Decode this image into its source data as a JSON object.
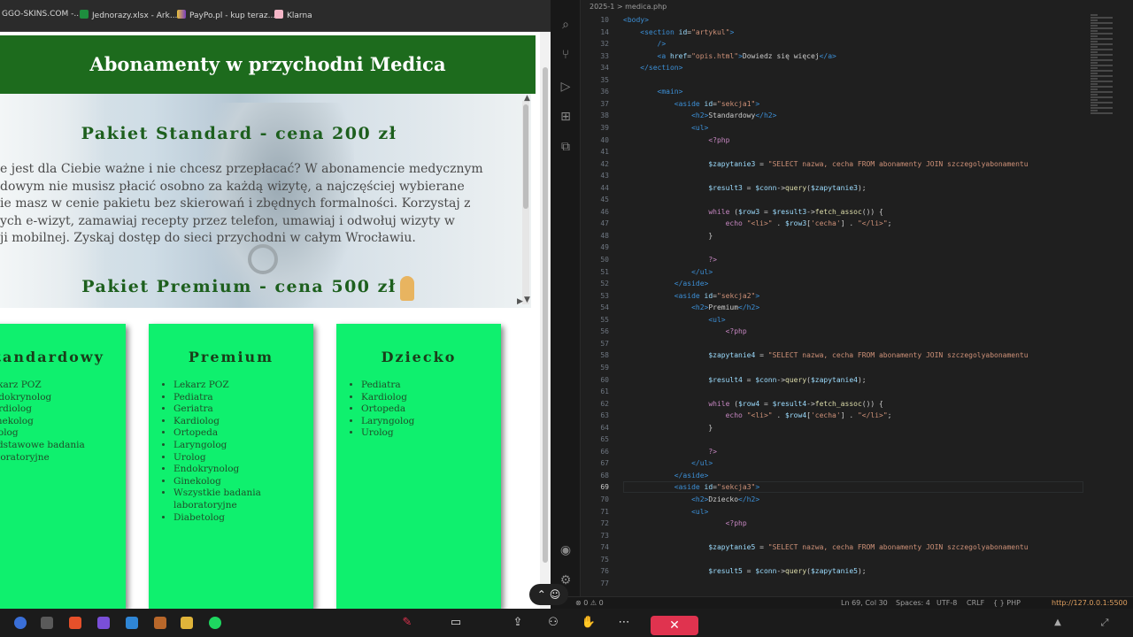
{
  "bookmarks": [
    "GGO-SKINS.COM -...",
    "Jednorazy.xlsx - Ark...",
    "PayPo.pl - kup teraz...",
    "Klarna"
  ],
  "page": {
    "header": "Abonamenty w przychodni Medica",
    "article": {
      "h_standard": "Pakiet Standard - cena 200 zł",
      "text_lines": [
        "e jest dla Ciebie ważne i nie chcesz przepłacać? W abonamencie medycznym",
        "dowym nie musisz płacić osobno za każdą wizytę, a najczęściej wybierane",
        "ie masz w cenie pakietu bez skierowań i zbędnych formalności. Korzystaj z",
        "ych e-wizyt, zamawiaj recepty przez telefon, umawiaj i odwołuj wizyty w",
        "ji mobilnej. Zyskaj dostęp do sieci przychodni w całym Wrocławiu."
      ],
      "h_premium": "Pakiet Premium - cena 500 zł"
    },
    "cards": [
      {
        "title": "Standardowy",
        "items": [
          "Lekarz POZ",
          "Endokrynolog",
          "Kardiolog",
          "Ginekolog",
          "Urolog",
          "Podstawowe badania",
          "laboratoryjne"
        ]
      },
      {
        "title": "Premium",
        "items": [
          "Lekarz POZ",
          "Pediatra",
          "Geriatra",
          "Kardiolog",
          "Ortopeda",
          "Laryngolog",
          "Urolog",
          "Endokrynolog",
          "Ginekolog",
          "Wszystkie badania",
          "laboratoryjne",
          "Diabetolog"
        ]
      },
      {
        "title": "Dziecko",
        "items": [
          "Pediatra",
          "Kardiolog",
          "Ortopeda",
          "Laryngolog",
          "Urolog"
        ]
      }
    ]
  },
  "editor": {
    "breadcrumb": "2025-1 > medica.php",
    "lines": [
      {
        "n": "10",
        "html": "<span class='t'>&lt;body&gt;</span>"
      },
      {
        "n": "14",
        "html": "    <span class='t'>&lt;section</span> <span class='a'>id</span>=<span class='s'>\"artykul\"</span><span class='t'>&gt;</span>"
      },
      {
        "n": "32",
        "html": "        <span class='t'>/&gt;</span>"
      },
      {
        "n": "33",
        "html": "        <span class='t'>&lt;a</span> <span class='a'>href</span>=<span class='s'>\"opis.html\"</span><span class='t'>&gt;</span>Dowiedz się więcej<span class='t'>&lt;/a&gt;</span>"
      },
      {
        "n": "34",
        "html": "    <span class='t'>&lt;/section&gt;</span>"
      },
      {
        "n": "35",
        "html": ""
      },
      {
        "n": "36",
        "html": "        <span class='t'>&lt;main&gt;</span>"
      },
      {
        "n": "37",
        "html": "            <span class='t'>&lt;aside</span> <span class='a'>id</span>=<span class='s'>\"sekcja1\"</span><span class='t'>&gt;</span>"
      },
      {
        "n": "38",
        "html": "                <span class='t'>&lt;h2&gt;</span>Standardowy<span class='t'>&lt;/h2&gt;</span>"
      },
      {
        "n": "39",
        "html": "                <span class='t'>&lt;ul&gt;</span>"
      },
      {
        "n": "40",
        "html": "                    <span class='p'>&lt;?php</span>"
      },
      {
        "n": "41",
        "html": ""
      },
      {
        "n": "42",
        "html": "                    <span class='v'>$zapytanie3</span> = <span class='s'>\"SELECT nazwa, cecha FROM abonamenty JOIN szczegolyabonamentu</span>"
      },
      {
        "n": "43",
        "html": ""
      },
      {
        "n": "44",
        "html": "                    <span class='v'>$result3</span> = <span class='v'>$conn</span>-&gt;<span class='f'>query</span>(<span class='v'>$zapytanie3</span>);"
      },
      {
        "n": "45",
        "html": ""
      },
      {
        "n": "46",
        "html": "                    <span class='p'>while</span> (<span class='v'>$row3</span> = <span class='v'>$result3</span>-&gt;<span class='f'>fetch_assoc</span>()) {"
      },
      {
        "n": "47",
        "html": "                        <span class='p'>echo</span> <span class='s'>\"&lt;li&gt;\"</span> . <span class='v'>$row3</span>[<span class='s'>'cecha'</span>] . <span class='s'>\"&lt;/li&gt;\"</span>;"
      },
      {
        "n": "48",
        "html": "                    }"
      },
      {
        "n": "49",
        "html": ""
      },
      {
        "n": "50",
        "html": "                    <span class='p'>?&gt;</span>"
      },
      {
        "n": "51",
        "html": "                <span class='t'>&lt;/ul&gt;</span>"
      },
      {
        "n": "52",
        "html": "            <span class='t'>&lt;/aside&gt;</span>"
      },
      {
        "n": "53",
        "html": "            <span class='t'>&lt;aside</span> <span class='a'>id</span>=<span class='s'>\"sekcja2\"</span><span class='t'>&gt;</span>"
      },
      {
        "n": "54",
        "html": "                <span class='t'>&lt;h2&gt;</span>Premium<span class='t'>&lt;/h2&gt;</span>"
      },
      {
        "n": "55",
        "html": "                    <span class='t'>&lt;ul&gt;</span>"
      },
      {
        "n": "56",
        "html": "                        <span class='p'>&lt;?php</span>"
      },
      {
        "n": "57",
        "html": ""
      },
      {
        "n": "58",
        "html": "                    <span class='v'>$zapytanie4</span> = <span class='s'>\"SELECT nazwa, cecha FROM abonamenty JOIN szczegolyabonamentu</span>"
      },
      {
        "n": "59",
        "html": ""
      },
      {
        "n": "60",
        "html": "                    <span class='v'>$result4</span> = <span class='v'>$conn</span>-&gt;<span class='f'>query</span>(<span class='v'>$zapytanie4</span>);"
      },
      {
        "n": "61",
        "html": ""
      },
      {
        "n": "62",
        "html": "                    <span class='p'>while</span> (<span class='v'>$row4</span> = <span class='v'>$result4</span>-&gt;<span class='f'>fetch_assoc</span>()) {"
      },
      {
        "n": "63",
        "html": "                        <span class='p'>echo</span> <span class='s'>\"&lt;li&gt;\"</span> . <span class='v'>$row4</span>[<span class='s'>'cecha'</span>] . <span class='s'>\"&lt;/li&gt;\"</span>;"
      },
      {
        "n": "64",
        "html": "                    }"
      },
      {
        "n": "65",
        "html": ""
      },
      {
        "n": "66",
        "html": "                    <span class='p'>?&gt;</span>"
      },
      {
        "n": "67",
        "html": "                <span class='t'>&lt;/ul&gt;</span>"
      },
      {
        "n": "68",
        "html": "            <span class='t'>&lt;/aside&gt;</span>"
      },
      {
        "n": "69",
        "html": "            <span class='t'>&lt;aside</span> <span class='a'>id</span>=<span class='s'>\"sekcja3\"</span><span class='t'>&gt;</span>",
        "cur": true
      },
      {
        "n": "70",
        "html": "                <span class='t'>&lt;h2&gt;</span>Dziecko<span class='t'>&lt;/h2&gt;</span>"
      },
      {
        "n": "71",
        "html": "                <span class='t'>&lt;ul&gt;</span>"
      },
      {
        "n": "72",
        "html": "                        <span class='p'>&lt;?php</span>"
      },
      {
        "n": "73",
        "html": ""
      },
      {
        "n": "74",
        "html": "                    <span class='v'>$zapytanie5</span> = <span class='s'>\"SELECT nazwa, cecha FROM abonamenty JOIN szczegolyabonamentu</span>"
      },
      {
        "n": "75",
        "html": ""
      },
      {
        "n": "76",
        "html": "                    <span class='v'>$result5</span> = <span class='v'>$conn</span>-&gt;<span class='f'>query</span>(<span class='v'>$zapytanie5</span>);"
      },
      {
        "n": "77",
        "html": ""
      }
    ]
  },
  "status": {
    "problems": "⊗ 0 ⚠ 0",
    "position": "Ln 69, Col 30",
    "spaces": "Spaces: 4",
    "encoding": "UTF-8",
    "eol": "CRLF",
    "lang": "{ } PHP",
    "url": "http://127.0.0.1:5500"
  },
  "colors": {
    "header_green": "#1d6b1d",
    "card_green": "#0ff06e",
    "end_call": "#e0334f"
  }
}
